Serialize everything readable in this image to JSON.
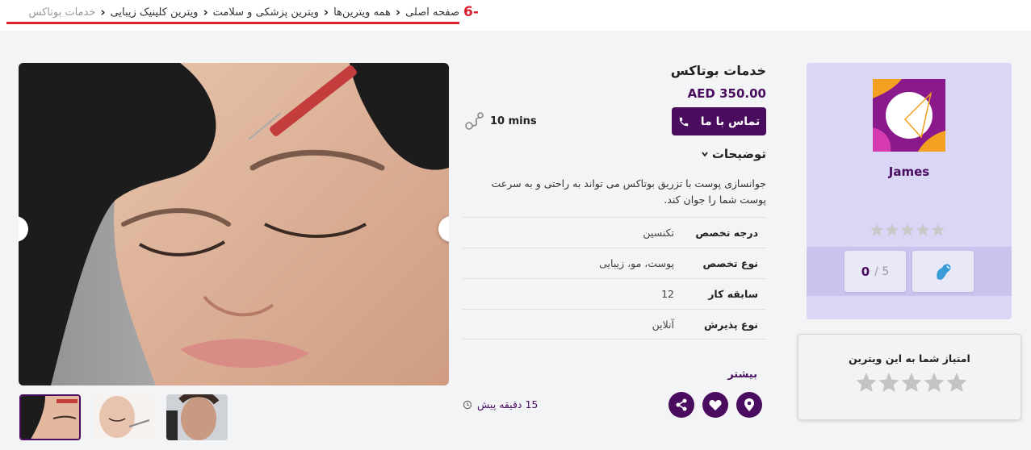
{
  "breadcrumb": {
    "items": [
      {
        "label": "صفحه اصلی"
      },
      {
        "label": "همه ویترین‌ها"
      },
      {
        "label": "ویترین پزشکی و سلامت"
      },
      {
        "label": "ویترین کلینیک زیبایی"
      }
    ],
    "current": "خدمات بوتاکس",
    "marker": "6-"
  },
  "service": {
    "title": "خدمات بوتاکس",
    "price": "AED 350.00",
    "contact_label": "تماس با ما",
    "duration": "10 mins",
    "description_heading": "توضیحات",
    "description": "جوانسازی پوست با تزریق بوتاکس می تواند به راحتی و به سرعت پوست شما را جوان کند.",
    "details": [
      {
        "label": "درجه تخصص",
        "value": "تکنسین"
      },
      {
        "label": "نوع تخصص",
        "value": "پوست، مو، زیبایی"
      },
      {
        "label": "سابقه کار",
        "value": "12"
      },
      {
        "label": "نوع پذیرش",
        "value": "آنلاین"
      }
    ],
    "more_label": "بیشتر",
    "posted": "15 دقیقه پیش"
  },
  "vendor": {
    "name": "James",
    "rating_score": "0",
    "rating_max": "/ 5",
    "your_rating_label": "امتیاز شما به این ویترین"
  },
  "colors": {
    "accent": "#4a0c5e",
    "breadcrumb_underline": "#dc1f2e",
    "vendor_card": "#dad6f6"
  }
}
